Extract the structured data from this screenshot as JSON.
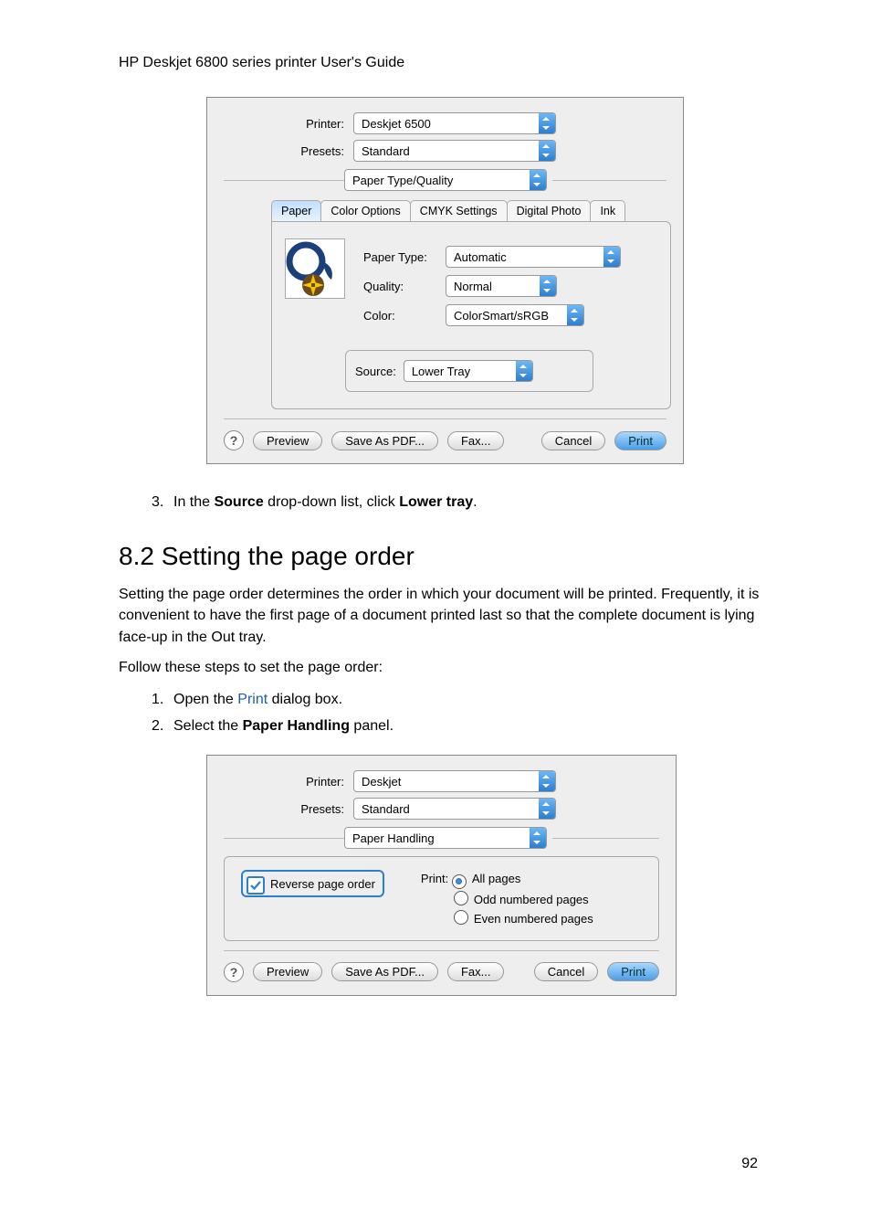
{
  "header": {
    "doc_title": "HP Deskjet 6800 series printer User's Guide"
  },
  "dialog1": {
    "printer_label": "Printer:",
    "printer_value": "Deskjet 6500",
    "presets_label": "Presets:",
    "presets_value": "Standard",
    "panel_value": "Paper Type/Quality",
    "tabs": {
      "paper": "Paper",
      "color_options": "Color Options",
      "cmyk": "CMYK Settings",
      "digital_photo": "Digital Photo",
      "ink": "Ink"
    },
    "paper_type_label": "Paper Type:",
    "paper_type_value": "Automatic",
    "quality_label": "Quality:",
    "quality_value": "Normal",
    "color_label": "Color:",
    "color_value": "ColorSmart/sRGB",
    "source_label": "Source:",
    "source_value": "Lower Tray",
    "buttons": {
      "help": "?",
      "preview": "Preview",
      "save_pdf": "Save As PDF...",
      "fax": "Fax...",
      "cancel": "Cancel",
      "print": "Print"
    }
  },
  "step3": {
    "num": "3.",
    "text_pre": "In the ",
    "bold1": "Source",
    "text_mid": " drop-down list, click ",
    "bold2": "Lower tray",
    "text_post": "."
  },
  "section": {
    "heading": "8.2  Setting the page order",
    "para1": "Setting the page order determines the order in which your document will be printed. Frequently, it is convenient to have the first page of a document printed last so that the complete document is lying face-up in the Out tray.",
    "para2": "Follow these steps to set the page order:",
    "step1": {
      "num": "1.",
      "pre": "Open the ",
      "link": "Print",
      "post": " dialog box."
    },
    "step2": {
      "num": "2.",
      "pre": "Select the ",
      "bold": "Paper Handling",
      "post": " panel."
    }
  },
  "dialog2": {
    "printer_label": "Printer:",
    "printer_value": "Deskjet",
    "presets_label": "Presets:",
    "presets_value": "Standard",
    "panel_value": "Paper Handling",
    "reverse_label": "Reverse page order",
    "print_label": "Print:",
    "radio_all": "All pages",
    "radio_odd": "Odd numbered pages",
    "radio_even": "Even numbered pages",
    "buttons": {
      "help": "?",
      "preview": "Preview",
      "save_pdf": "Save As PDF...",
      "fax": "Fax...",
      "cancel": "Cancel",
      "print": "Print"
    }
  },
  "page_number": "92"
}
